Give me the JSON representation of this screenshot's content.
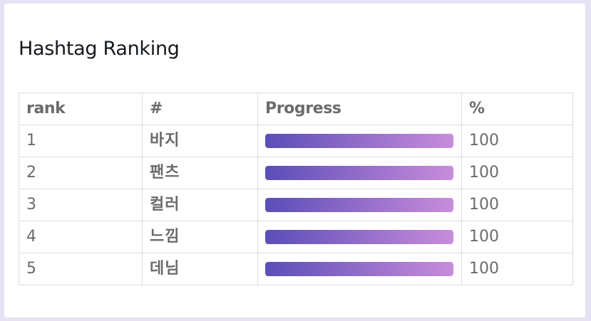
{
  "page": {
    "title": "Hashtag Ranking"
  },
  "table": {
    "headers": [
      "rank",
      "#",
      "Progress",
      "%"
    ],
    "rows": [
      {
        "rank": "1",
        "hashtag": "바지",
        "progress": 1.0,
        "percent": "100"
      },
      {
        "rank": "2",
        "hashtag": "팬츠",
        "progress": 1.0,
        "percent": "100"
      },
      {
        "rank": "3",
        "hashtag": "컬러",
        "progress": 1.0,
        "percent": "100"
      },
      {
        "rank": "4",
        "hashtag": "느낌",
        "progress": 1.0,
        "percent": "100"
      },
      {
        "rank": "5",
        "hashtag": "데님",
        "progress": 1.0,
        "percent": "100"
      }
    ]
  },
  "colors": {
    "background": "#e6e2f3",
    "bar_gradient_start": "#5a4db8",
    "bar_gradient_end": "#c98cdc",
    "text": "#6b6b6b",
    "title": "#14181c"
  }
}
